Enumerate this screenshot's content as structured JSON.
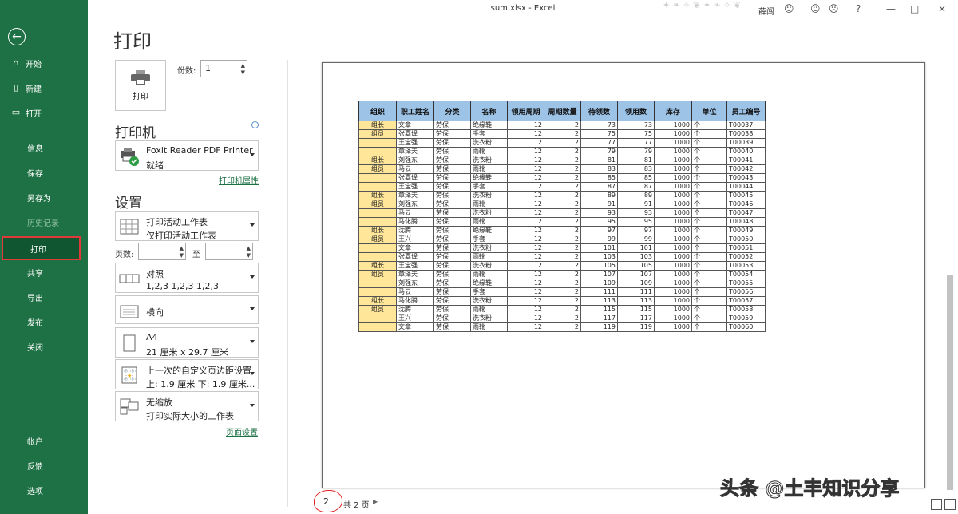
{
  "window": {
    "title": "sum.xlsx  -  Excel",
    "user": "薛闯",
    "controls": [
      "?",
      "—",
      "□",
      "×"
    ]
  },
  "sidebar": {
    "items": [
      {
        "label": "开始",
        "icon": "home-icon",
        "glyph": "⌂"
      },
      {
        "label": "新建",
        "icon": "new-document-icon",
        "glyph": "▯"
      },
      {
        "label": "打开",
        "icon": "open-folder-icon",
        "glyph": "▭"
      },
      {
        "label": "信息"
      },
      {
        "label": "保存"
      },
      {
        "label": "另存为"
      },
      {
        "label": "历史记录",
        "disabled": true
      },
      {
        "label": "打印",
        "active": true
      },
      {
        "label": "共享"
      },
      {
        "label": "导出"
      },
      {
        "label": "发布"
      },
      {
        "label": "关闭"
      },
      {
        "label": "帐户"
      },
      {
        "label": "反馈"
      },
      {
        "label": "选项"
      }
    ]
  },
  "print": {
    "title": "打印",
    "button_label": "打印",
    "copies_label": "份数:",
    "copies_value": "1",
    "printer_heading": "打印机",
    "printer_name": "Foxit Reader PDF Printer",
    "printer_status": "就绪",
    "printer_properties": "打印机属性",
    "settings_heading": "设置",
    "settings": [
      {
        "line1": "打印活动工作表",
        "line2": "仅打印活动工作表"
      },
      {
        "line1": "对照",
        "line2": "1,2,3     1,2,3     1,2,3"
      },
      {
        "line1": "横向"
      },
      {
        "line1": "A4",
        "line2": "21 厘米 x 29.7 厘米"
      },
      {
        "line1": "上一次的自定义页边距设置",
        "line2": "上: 1.9 厘米 下: 1.9 厘米..."
      },
      {
        "line1": "无缩放",
        "line2": "打印实际大小的工作表"
      }
    ],
    "pages_label": "页数:",
    "to_label": "至",
    "page_setup": "页面设置"
  },
  "preview": {
    "current_page": "2",
    "total_pages": "共 2 页",
    "watermark": "头条 @土丰知识分享",
    "table": {
      "headers": [
        "组织",
        "职工姓名",
        "分类",
        "名称",
        "领用周期",
        "周期数量",
        "待领数",
        "领用数",
        "库存",
        "单位",
        "员工编号"
      ],
      "rows": [
        [
          "组长",
          "文章",
          "劳保",
          "绝缘鞋",
          "12",
          "2",
          "73",
          "73",
          "1000",
          "个",
          "T00037"
        ],
        [
          "组员",
          "张嘉译",
          "劳保",
          "手套",
          "12",
          "2",
          "75",
          "75",
          "1000",
          "个",
          "T00038"
        ],
        [
          "",
          "王宝强",
          "劳保",
          "洗衣粉",
          "12",
          "2",
          "77",
          "77",
          "1000",
          "个",
          "T00039"
        ],
        [
          "",
          "章泽天",
          "劳保",
          "雨靴",
          "12",
          "2",
          "79",
          "79",
          "1000",
          "个",
          "T00040"
        ],
        [
          "组长",
          "刘强东",
          "劳保",
          "洗衣粉",
          "12",
          "2",
          "81",
          "81",
          "1000",
          "个",
          "T00041"
        ],
        [
          "组员",
          "马云",
          "劳保",
          "雨靴",
          "12",
          "2",
          "83",
          "83",
          "1000",
          "个",
          "T00042"
        ],
        [
          "",
          "张嘉译",
          "劳保",
          "绝缘鞋",
          "12",
          "2",
          "85",
          "85",
          "1000",
          "个",
          "T00043"
        ],
        [
          "",
          "王宝强",
          "劳保",
          "手套",
          "12",
          "2",
          "87",
          "87",
          "1000",
          "个",
          "T00044"
        ],
        [
          "组长",
          "章泽天",
          "劳保",
          "洗衣粉",
          "12",
          "2",
          "89",
          "89",
          "1000",
          "个",
          "T00045"
        ],
        [
          "组员",
          "刘强东",
          "劳保",
          "雨靴",
          "12",
          "2",
          "91",
          "91",
          "1000",
          "个",
          "T00046"
        ],
        [
          "",
          "马云",
          "劳保",
          "洗衣粉",
          "12",
          "2",
          "93",
          "93",
          "1000",
          "个",
          "T00047"
        ],
        [
          "",
          "马化腾",
          "劳保",
          "雨靴",
          "12",
          "2",
          "95",
          "95",
          "1000",
          "个",
          "T00048"
        ],
        [
          "组长",
          "沈腾",
          "劳保",
          "绝缘鞋",
          "12",
          "2",
          "97",
          "97",
          "1000",
          "个",
          "T00049"
        ],
        [
          "组员",
          "王兴",
          "劳保",
          "手套",
          "12",
          "2",
          "99",
          "99",
          "1000",
          "个",
          "T00050"
        ],
        [
          "",
          "文章",
          "劳保",
          "洗衣粉",
          "12",
          "2",
          "101",
          "101",
          "1000",
          "个",
          "T00051"
        ],
        [
          "",
          "张嘉译",
          "劳保",
          "雨靴",
          "12",
          "2",
          "103",
          "103",
          "1000",
          "个",
          "T00052"
        ],
        [
          "组长",
          "王宝强",
          "劳保",
          "洗衣粉",
          "12",
          "2",
          "105",
          "105",
          "1000",
          "个",
          "T00053"
        ],
        [
          "组员",
          "章泽天",
          "劳保",
          "雨靴",
          "12",
          "2",
          "107",
          "107",
          "1000",
          "个",
          "T00054"
        ],
        [
          "",
          "刘强东",
          "劳保",
          "绝缘鞋",
          "12",
          "2",
          "109",
          "109",
          "1000",
          "个",
          "T00055"
        ],
        [
          "",
          "马云",
          "劳保",
          "手套",
          "12",
          "2",
          "111",
          "111",
          "1000",
          "个",
          "T00056"
        ],
        [
          "组长",
          "马化腾",
          "劳保",
          "洗衣粉",
          "12",
          "2",
          "113",
          "113",
          "1000",
          "个",
          "T00057"
        ],
        [
          "组员",
          "沈腾",
          "劳保",
          "雨靴",
          "12",
          "2",
          "115",
          "115",
          "1000",
          "个",
          "T00058"
        ],
        [
          "",
          "王兴",
          "劳保",
          "洗衣粉",
          "12",
          "2",
          "117",
          "117",
          "1000",
          "个",
          "T00059"
        ],
        [
          "",
          "文章",
          "劳保",
          "雨靴",
          "12",
          "2",
          "119",
          "119",
          "1000",
          "个",
          "T00060"
        ]
      ]
    }
  },
  "colors": {
    "sidebar": "#1e7145",
    "sidebar_active": "#0f5631",
    "highlight_red": "#e03a3a",
    "header_blue": "#9dc3e6",
    "group_yellow": "#ffe699"
  }
}
